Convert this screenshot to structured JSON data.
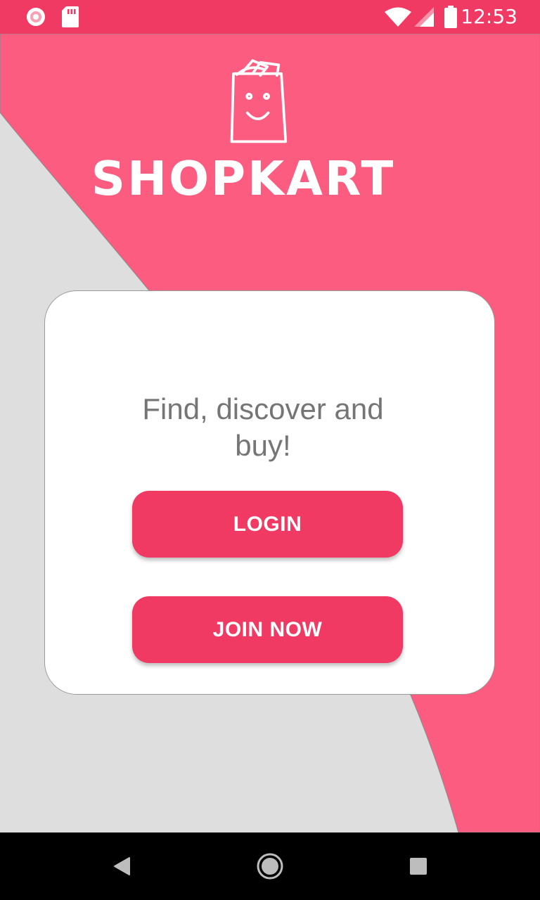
{
  "status_bar": {
    "time": "12:53",
    "icons": [
      "chrome-sync-icon",
      "sd-card-icon",
      "wifi-icon",
      "signal-icon",
      "battery-icon"
    ]
  },
  "brand": {
    "name": "SHOPKART",
    "logo_icon": "shopping-bag-smile-icon"
  },
  "card": {
    "tagline": "Find, discover and buy!",
    "login_label": "LOGIN",
    "join_label": "JOIN NOW"
  },
  "nav_bar": {
    "icons": [
      "back-icon",
      "home-icon",
      "recents-icon"
    ]
  },
  "colors": {
    "primary": "#f03a63",
    "background_pink": "#fb5c80",
    "background_gray": "#dedede",
    "card": "#ffffff",
    "text_gray": "#757575"
  }
}
